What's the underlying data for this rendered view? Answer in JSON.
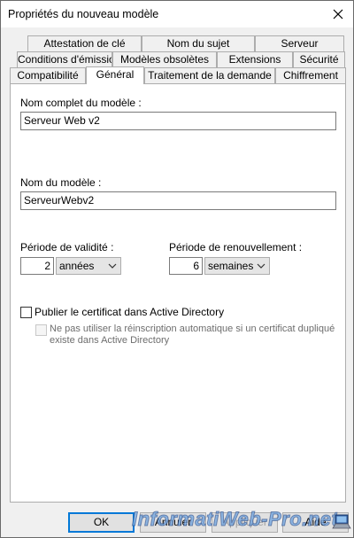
{
  "window": {
    "title": "Propriétés du nouveau modèle"
  },
  "tabs": {
    "row1": [
      "Attestation de clé",
      "Nom du sujet",
      "Serveur"
    ],
    "row2": [
      "Conditions d'émission",
      "Modèles obsolètes",
      "Extensions",
      "Sécurité"
    ],
    "row3": [
      "Compatibilité",
      "Général",
      "Traitement de la demande",
      "Chiffrement"
    ],
    "active": "Général"
  },
  "general": {
    "display_name_label": "Nom complet du modèle :",
    "display_name_value": "Serveur Web v2",
    "template_name_label": "Nom du modèle :",
    "template_name_value": "ServeurWebv2",
    "validity_label": "Période de validité :",
    "validity_value": "2",
    "validity_unit": "années",
    "renewal_label": "Période de renouvellement :",
    "renewal_value": "6",
    "renewal_unit": "semaines",
    "publish_label": "Publier le certificat dans Active Directory",
    "publish_checked": false,
    "no_reenroll_line1": "Ne pas utiliser la réinscription automatique si un certificat dupliqué",
    "no_reenroll_line2": "existe dans Active Directory",
    "no_reenroll_checked": false
  },
  "buttons": {
    "ok": "OK",
    "cancel": "Annuler",
    "apply": "Appliquer",
    "help": "Aide"
  },
  "watermark": {
    "text": "InformatiWeb-Pro.net"
  },
  "icons": {
    "close": "close-icon",
    "chevron": "chevron-down-icon",
    "watermark_logo": "laptop-icon"
  }
}
